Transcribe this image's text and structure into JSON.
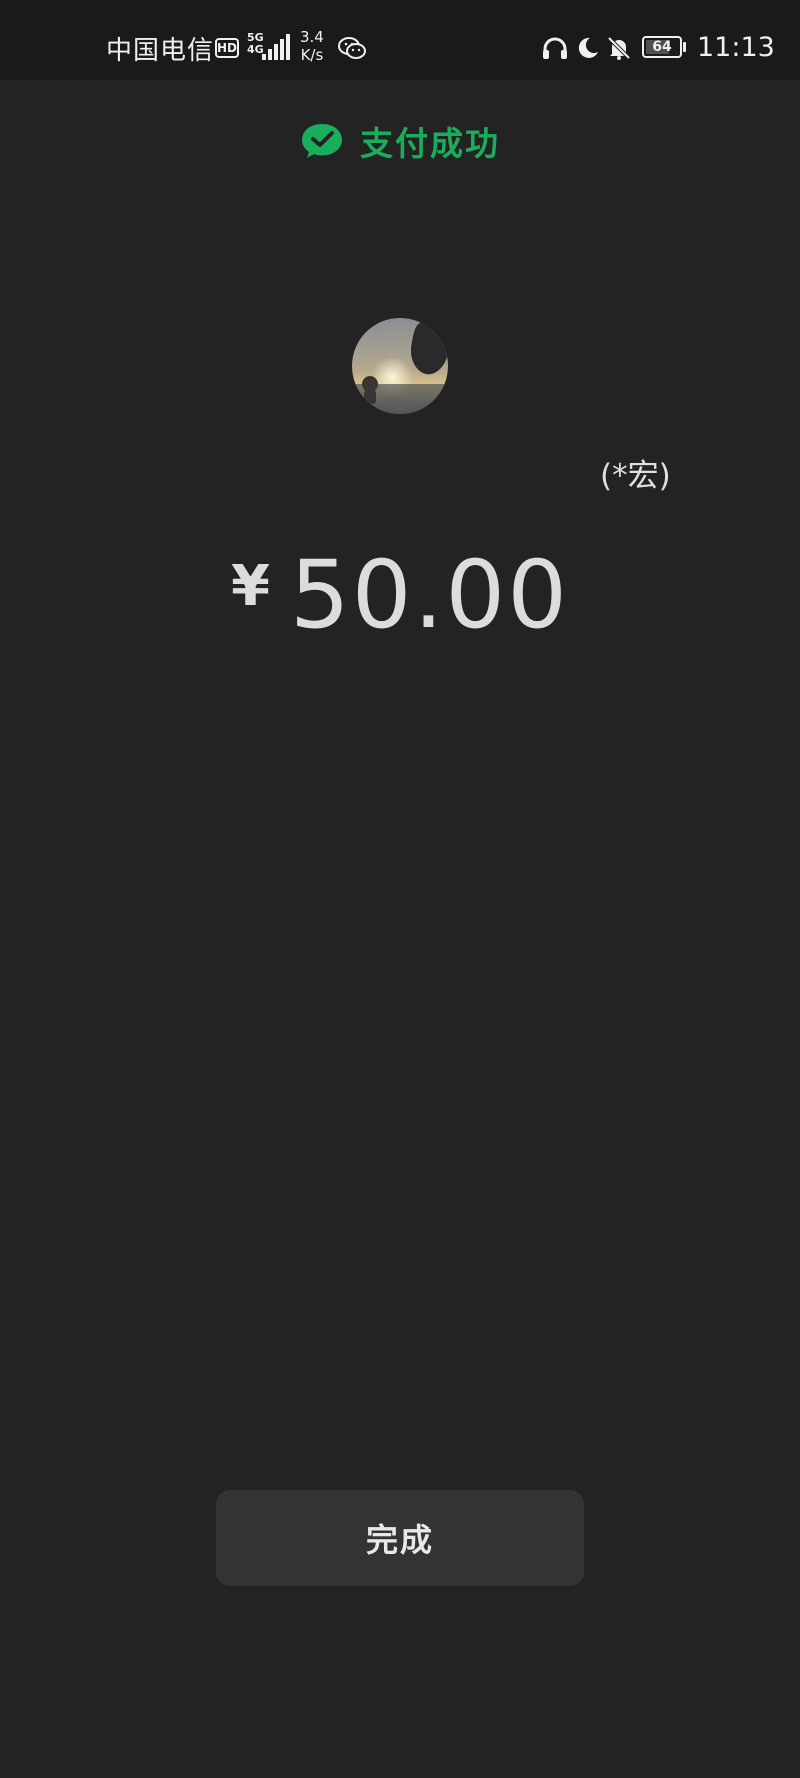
{
  "status_bar": {
    "carrier": "中国电信",
    "hd": "HD",
    "network": "5G\n4G",
    "speed_value": "3.4",
    "speed_unit": "K/s",
    "battery": "64",
    "time": "11:13"
  },
  "header": {
    "title": "支付成功",
    "icon": "wechat-pay-check-icon",
    "accent_color": "#1aad5c"
  },
  "payee": {
    "name": "(*宏)"
  },
  "payment": {
    "currency_symbol": "¥",
    "amount": "50.00"
  },
  "actions": {
    "done_label": "完成"
  }
}
